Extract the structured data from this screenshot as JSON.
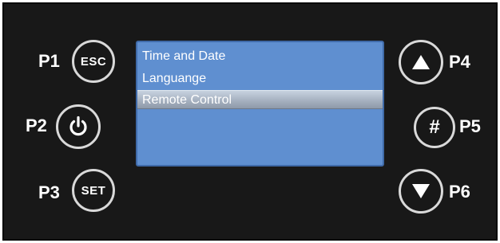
{
  "labels": {
    "p1": "P1",
    "p2": "P2",
    "p3": "P3",
    "p4": "P4",
    "p5": "P5",
    "p6": "P6"
  },
  "buttons": {
    "esc": "ESC",
    "set": "SET",
    "hash": "#",
    "power_icon": "power-icon",
    "up_icon": "up-arrow-icon",
    "down_icon": "down-arrow-icon"
  },
  "menu": {
    "items": [
      {
        "label": "Time and Date",
        "selected": false
      },
      {
        "label": "Languange",
        "selected": false
      },
      {
        "label": "Remote Control",
        "selected": true
      }
    ]
  },
  "colors": {
    "panel": "#181818",
    "screen": "#5f8fd0",
    "button_border": "#d9d9d9",
    "text": "#ffffff"
  }
}
